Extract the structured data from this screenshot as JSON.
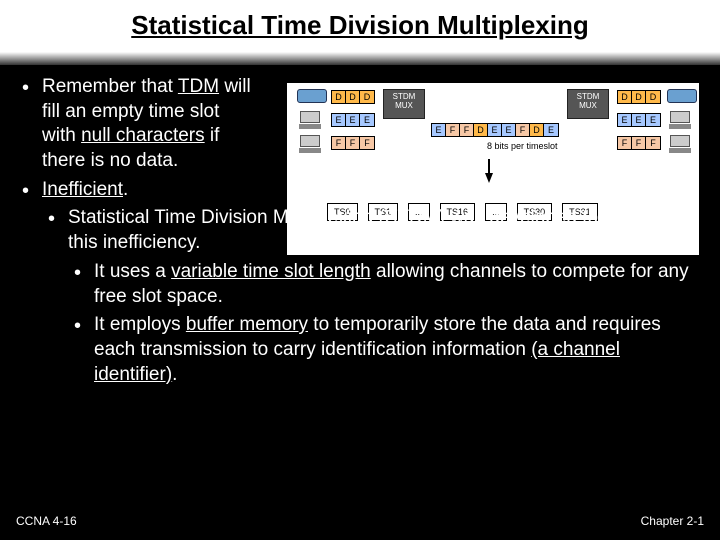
{
  "title": "Statistical Time Division Multiplexing",
  "bullets": {
    "b1_part1": "Remember that ",
    "b1_tdm": "TDM",
    "b1_part2": " will fill an empty time slot with ",
    "b1_null": "null characters",
    "b1_part3": " if there is no data.",
    "b2": "Inefficient",
    "b2_dot": ".",
    "b3_part1": "Statistical Time Division Multiplexing ",
    "b3_stdm": "(STDM)",
    "b3_part2": " was developed to overcome this inefficiency.",
    "b4_part1": "It uses a ",
    "b4_var": "variable time slot length",
    "b4_part2": " allowing channels to compete for any free slot space.",
    "b5_part1": "It employs ",
    "b5_buf": "buffer memory",
    "b5_part2": " to temporarily store the data and requires each transmission to carry identification information ",
    "b5_chan": "(a channel identifier)",
    "b5_dot": "."
  },
  "footer": {
    "left": "CCNA 4-16",
    "right": "Chapter 2-1"
  },
  "diagram": {
    "mux_label": "STDM MUX",
    "bits_label": "8 bits per timeslot",
    "row_top_left": [
      "D",
      "D",
      "D"
    ],
    "row_top_right": [
      "D",
      "D",
      "D"
    ],
    "row_e_left": [
      "E",
      "E",
      "E"
    ],
    "row_e_right": [
      "E",
      "E",
      "E"
    ],
    "row_f_left": [
      "F",
      "F",
      "F"
    ],
    "row_f_right": [
      "F",
      "F",
      "F"
    ],
    "row_mid": [
      "E",
      "F",
      "F",
      "D",
      "E",
      "E",
      "F",
      "D",
      "E"
    ],
    "ts": [
      "TS0",
      "TS1",
      "...",
      "TS16",
      "...",
      "TS30",
      "TS31"
    ]
  }
}
